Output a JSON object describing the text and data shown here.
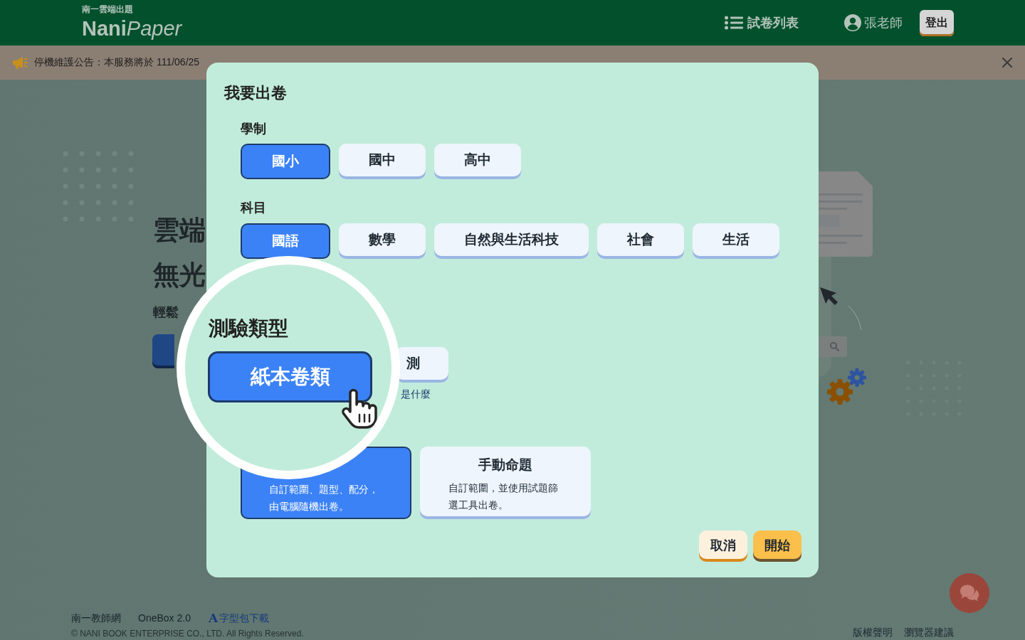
{
  "header": {
    "tagline": "南一雲端出題",
    "wordmark": "**Nani**Paper",
    "exam_list": "試卷列表",
    "user_name": "張老師",
    "logout": "登出"
  },
  "notice": {
    "text": "停機維護公告：本服務將於 111/06/25"
  },
  "hero": {
    "headlines": [
      "雲端",
      "無光"
    ],
    "subtitle": "輕鬆"
  },
  "dialog": {
    "title": "我要出卷",
    "school_level": {
      "label": "學制",
      "options": [
        {
          "label": "國小",
          "selected": true
        },
        {
          "label": "國中",
          "selected": false
        },
        {
          "label": "高中",
          "selected": false
        }
      ]
    },
    "subject": {
      "label": "科目",
      "options": [
        {
          "label": "國語",
          "selected": true
        },
        {
          "label": "數學",
          "selected": false
        },
        {
          "label": "自然與生活科技",
          "selected": false
        },
        {
          "label": "社會",
          "selected": false
        },
        {
          "label": "生活",
          "selected": false
        }
      ]
    },
    "test_type": {
      "options": [
        {
          "label": "測",
          "selected": false
        }
      ],
      "hint": "是什麼"
    },
    "magnifier": {
      "label": "測驗類型",
      "option": {
        "label": "紙本卷類",
        "selected": true
      }
    },
    "modes": [
      {
        "description": "自訂範圍、題型、配分，由電腦隨機出卷。",
        "selected": true
      },
      {
        "title": "手動命題",
        "description": "自訂範圍，並使用試題篩選工具出卷。",
        "selected": false
      }
    ],
    "actions": [
      {
        "label": "取消",
        "kind": "secondary"
      },
      {
        "label": "開始",
        "kind": "primary"
      }
    ]
  },
  "footer": {
    "links": [
      {
        "label": "南一教師網"
      },
      {
        "label": "OneBox 2.0"
      },
      {
        "label": "字型包下載",
        "glyph": "A"
      }
    ],
    "copyright": "© NANI BOOK ENTERPRISE CO., LTD. All Rights Reserved.",
    "legal_links": [
      "版權聲明",
      "瀏覽器建議"
    ]
  }
}
